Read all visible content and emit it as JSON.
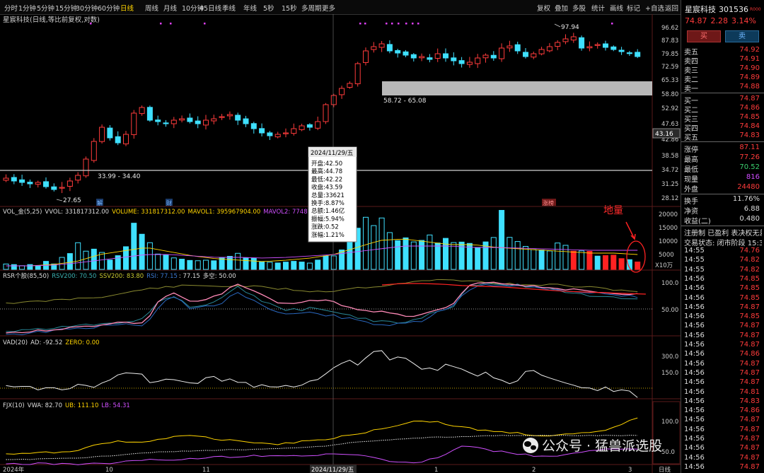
{
  "toolbar": {
    "periods": [
      "分时",
      "1分钟",
      "5分钟",
      "15分钟",
      "30分钟",
      "60分钟",
      "日线",
      "周线",
      "月线",
      "10分钟",
      "45日线",
      "季线",
      "年线",
      "5秒",
      "15秒",
      "多周期",
      "更多"
    ],
    "active": "日线",
    "right_items": [
      "复权",
      "叠加",
      "多股",
      "统计",
      "画线",
      "标记",
      "+自选",
      "返回"
    ]
  },
  "chart": {
    "title": "星宸科技(日线,等比前复权,对数)",
    "price_axis": [
      "96.62",
      "87.83",
      "79.85",
      "72.59",
      "65.33",
      "58.80",
      "52.92",
      "47.63",
      "42.86",
      "38.58",
      "34.72",
      "31.25",
      "28.12"
    ],
    "price_tag": "43.16",
    "high_label": "97.94",
    "low_label": "27.65",
    "zone_upper_label": "58.72 - 65.08",
    "zone_lower_label": "33.99 - 34.40",
    "markers": {
      "jie": "解",
      "cai": "财",
      "zhang": "涨榜"
    },
    "x_axis": [
      "2024年",
      "10",
      "11",
      "2024/11/29/五",
      "1",
      "2",
      "3"
    ],
    "corner_label": "日线",
    "annotation": "地量",
    "watermark": "公众号 · 猛兽派选股",
    "tooltip": {
      "date": "2024/11/29/五",
      "lines": [
        "开盘:42.50",
        "最高:44.78",
        "最低:42.22",
        "收盘:43.59",
        "总量:33621",
        "换手:8.87%",
        "总额:1.46亿",
        "振幅:5.94%",
        "涨跌:0.52",
        "涨幅:1.21%"
      ]
    },
    "vol": {
      "name": "VOL_金(5,25)",
      "vvol": "VVOL: 331817312.00",
      "volume": "VOLUME: 331817312.00",
      "mavol1": "MAVOL1: 395967904.00",
      "mavol2": "MAVOL2: 7748",
      "axis": [
        "20000",
        "15000",
        "10000",
        "5000"
      ],
      "unit": "X10万",
      "colors": {
        "volume": "#ffd400",
        "mavol1": "#ffd400",
        "mavol2": "#d050ff"
      }
    },
    "rsr": {
      "name": "RSR个股(85,50)",
      "rsv200": "RSV200: 70.50",
      "ssv200": "SSV200: 83.80",
      "rsi": "RSI: 77.15",
      "sep": ": 77.15",
      "duokong": "多空: 50.00",
      "axis": [
        "100.0",
        "50.00"
      ]
    },
    "vad": {
      "name": "VAD(20)",
      "ad": "AD: -92.52",
      "zero": "ZERO: 0.00",
      "axis": [
        "300.0",
        "150.0"
      ]
    },
    "fjx": {
      "name": "FJX(10)",
      "vwa": "VWA: 82.70",
      "ub": "UB: 111.10",
      "lb": "LB: 54.31",
      "axis": [
        "100.0",
        "50.0"
      ]
    }
  },
  "side": {
    "name": "星宸科技",
    "code": "301536",
    "badge": "R000",
    "price": "74.87",
    "change": "2.28",
    "pct": "3.14%",
    "buy_label": "买",
    "sell_label": "卖",
    "asks": [
      {
        "label": "卖五",
        "price": "74.92"
      },
      {
        "label": "卖四",
        "price": "74.91"
      },
      {
        "label": "卖三",
        "price": "74.90"
      },
      {
        "label": "卖二",
        "price": "74.89"
      },
      {
        "label": "卖一",
        "price": "74.88"
      }
    ],
    "bids": [
      {
        "label": "买一",
        "price": "74.87"
      },
      {
        "label": "买二",
        "price": "74.86"
      },
      {
        "label": "买三",
        "price": "74.85"
      },
      {
        "label": "买四",
        "price": "74.84"
      },
      {
        "label": "买五",
        "price": "74.83"
      }
    ],
    "stats": [
      {
        "label": "涨停",
        "value": "87.11",
        "color": "#ff3b3b"
      },
      {
        "label": "最高",
        "value": "77.26",
        "color": "#ff3b3b"
      },
      {
        "label": "最低",
        "value": "70.52",
        "color": "#3bd16f"
      },
      {
        "label": "现量",
        "value": "816",
        "color": "#d04cff"
      },
      {
        "label": "外盘",
        "value": "24480",
        "color": "#ff3b3b"
      }
    ],
    "stats2": [
      {
        "label": "换手",
        "value": "11.76%",
        "color": "#ddd"
      },
      {
        "label": "净资",
        "value": "6.88",
        "color": "#ddd"
      },
      {
        "label": "收益(二)",
        "value": "0.480",
        "color": "#ddd"
      }
    ],
    "reg_info": "注册制 已盈利 表决权无差",
    "trade_status": "交易状态: 闭市阶段 15:30",
    "trades": [
      [
        "14:55",
        "74.76"
      ],
      [
        "14:55",
        "74.82"
      ],
      [
        "14:55",
        "74.82"
      ],
      [
        "14:56",
        "74.85"
      ],
      [
        "14:56",
        "74.85"
      ],
      [
        "14:56",
        "74.85"
      ],
      [
        "14:56",
        "74.87"
      ],
      [
        "14:56",
        "74.85"
      ],
      [
        "14:56",
        "74.87"
      ],
      [
        "14:56",
        "74.87"
      ],
      [
        "14:56",
        "74.87"
      ],
      [
        "14:56",
        "74.86"
      ],
      [
        "14:56",
        "74.87"
      ],
      [
        "14:56",
        "74.87"
      ],
      [
        "14:56",
        "74.87"
      ],
      [
        "14:56",
        "74.81"
      ],
      [
        "14:56",
        "74.83"
      ],
      [
        "14:56",
        "74.86"
      ],
      [
        "14:56",
        "74.87"
      ],
      [
        "14:56",
        "74.87"
      ],
      [
        "14:56",
        "74.87"
      ],
      [
        "14:56",
        "74.87"
      ],
      [
        "14:56",
        "74.87"
      ],
      [
        "14:56",
        "74.87"
      ]
    ]
  }
}
